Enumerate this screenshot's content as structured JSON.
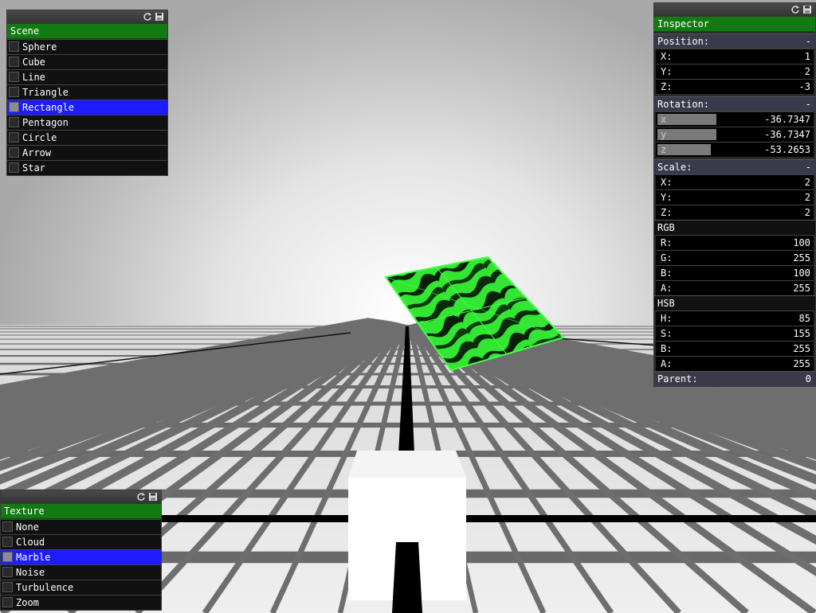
{
  "scene_panel": {
    "header": "Scene",
    "items": [
      {
        "label": "Sphere",
        "selected": false
      },
      {
        "label": "Cube",
        "selected": false
      },
      {
        "label": "Line",
        "selected": false
      },
      {
        "label": "Triangle",
        "selected": false
      },
      {
        "label": "Rectangle",
        "selected": true
      },
      {
        "label": "Pentagon",
        "selected": false
      },
      {
        "label": "Circle",
        "selected": false
      },
      {
        "label": "Arrow",
        "selected": false
      },
      {
        "label": "Star",
        "selected": false
      }
    ]
  },
  "texture_panel": {
    "header": "Texture",
    "items": [
      {
        "label": "None",
        "selected": false
      },
      {
        "label": "Cloud",
        "selected": false
      },
      {
        "label": "Marble",
        "selected": true
      },
      {
        "label": "Noise",
        "selected": false
      },
      {
        "label": "Turbulence",
        "selected": false
      },
      {
        "label": "Zoom",
        "selected": false
      }
    ]
  },
  "inspector": {
    "header": "Inspector",
    "position": {
      "title": "Position:",
      "collapse": "-",
      "x_label": "X:",
      "x": "1",
      "y_label": "Y:",
      "y": "2",
      "z_label": "Z:",
      "z": "-3"
    },
    "rotation": {
      "title": "Rotation:",
      "collapse": "-",
      "x_label": "x",
      "x": "-36.7347",
      "x_fill": 0.4,
      "y_label": "y",
      "y": "-36.7347",
      "y_fill": 0.4,
      "z_label": "z",
      "z": "-53.2653",
      "z_fill": 0.36
    },
    "scale": {
      "title": "Scale:",
      "collapse": "-",
      "x_label": "X:",
      "x": "2",
      "y_label": "Y:",
      "y": "2",
      "z_label": "Z:",
      "z": "2"
    },
    "rgb": {
      "title": "RGB",
      "r_label": "R:",
      "r": "100",
      "g_label": "G:",
      "g": "255",
      "b_label": "B:",
      "b": "100",
      "a_label": "A:",
      "a": "255"
    },
    "hsb": {
      "title": "HSB",
      "h_label": "H:",
      "h": "85",
      "s_label": "S:",
      "s": "155",
      "b_label": "B:",
      "b": "255",
      "a_label": "A:",
      "a": "255"
    },
    "parent_label": "Parent:",
    "parent": "0"
  },
  "icons": [
    "refresh-icon",
    "save-icon"
  ],
  "colors": {
    "header_green": "#137a13",
    "selected_blue": "#1c1cff",
    "section_bg": "#3a3a4a",
    "object_green": "#64ff64"
  }
}
